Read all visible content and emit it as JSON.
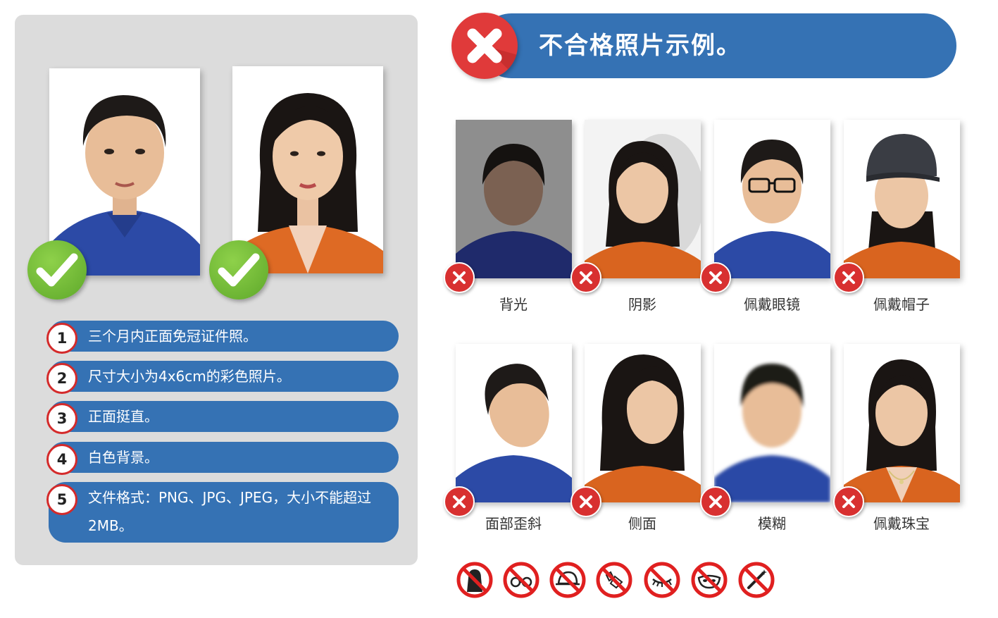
{
  "requirements": [
    {
      "num": "1",
      "text": "三个月内正面免冠证件照。"
    },
    {
      "num": "2",
      "text": "尺寸大小为4x6cm的彩色照片。"
    },
    {
      "num": "3",
      "text": "正面挺直。"
    },
    {
      "num": "4",
      "text": "白色背景。"
    },
    {
      "num": "5",
      "text": "文件格式：PNG、JPG、JPEG，大小不能超过2MB。"
    }
  ],
  "header": {
    "title": "不合格照片示例。"
  },
  "bad_examples": [
    {
      "caption": "背光"
    },
    {
      "caption": "阴影"
    },
    {
      "caption": "佩戴眼镜"
    },
    {
      "caption": "佩戴帽子"
    },
    {
      "caption": "面部歪斜"
    },
    {
      "caption": "侧面"
    },
    {
      "caption": "模糊"
    },
    {
      "caption": "佩戴珠宝"
    }
  ],
  "ban_icons": [
    "no-hair-covering-icon",
    "no-glasses-icon",
    "no-hat-icon",
    "no-earrings-icon",
    "no-false-eyelashes-icon",
    "no-mask-icon",
    "no-editing-icon"
  ],
  "colors": {
    "accent_blue": "#3572b4",
    "reject_red": "#d83030",
    "approve_green": "#6cb52f",
    "panel_gray": "#dcdcdc"
  }
}
